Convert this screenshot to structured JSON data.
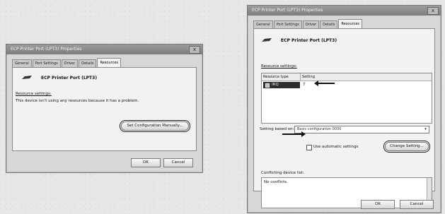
{
  "dialog_left": {
    "title": "ECP Printer Port (LPT3) Properties",
    "close_label": "x",
    "tabs": [
      "General",
      "Port Settings",
      "Driver",
      "Details",
      "Resources"
    ],
    "active_tab": "Resources",
    "device_name": "ECP Printer Port (LPT3)",
    "resource_settings_label": "Resource settings:",
    "message": "This device isn't using any resources because it has a problem.",
    "set_config_button": "Set Configuration Manually...",
    "ok_button": "OK",
    "cancel_button": "Cancel"
  },
  "dialog_right": {
    "title": "ECP Printer Port (LPT3) Properties",
    "close_label": "x",
    "tabs": [
      "General",
      "Port Settings",
      "Driver",
      "Details",
      "Resources"
    ],
    "active_tab": "Resources",
    "device_name": "ECP Printer Port (LPT3)",
    "resource_settings_label": "Resource settings:",
    "table_headers": [
      "Resource type",
      "Setting"
    ],
    "table_rows": [
      {
        "type": "IRQ",
        "setting": "7"
      }
    ],
    "setting_based_on_label": "Setting based on:",
    "setting_based_on_value": "Basic configuration 0000",
    "use_auto_label": "Use automatic settings",
    "change_setting_button": "Change Setting...",
    "conflicting_label": "Conflicting device list:",
    "conflicting_text": "No conflicts.",
    "ok_button": "OK",
    "cancel_button": "Cancel"
  },
  "colors": {
    "title_bar": "#8a8a8a",
    "panel": "#f2f2f2",
    "selected_row": "#2d2d2d"
  }
}
